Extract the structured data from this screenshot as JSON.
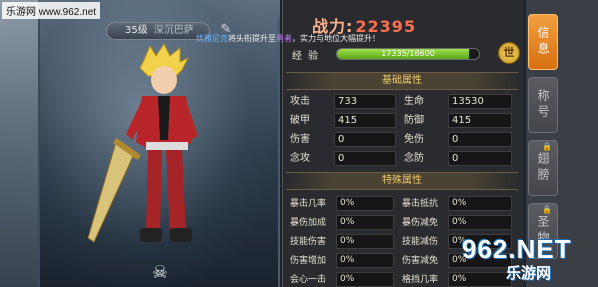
{
  "watermark": {
    "site": "乐游网 www.962.net",
    "logo_big": "962.NET",
    "logo_small": "乐游网"
  },
  "character": {
    "level": "35级",
    "name": "深沉巴萨",
    "bottom_item_icon": "skull-icon"
  },
  "banner": {
    "link": "优雅尼克",
    "text1": "将头衔提升至",
    "title": "勇者",
    "text2": "，实力与地位大幅提升！"
  },
  "power": {
    "label": "战力:",
    "value": "22395"
  },
  "exp": {
    "label": "经验",
    "text": "17335/18600",
    "fraction": 0.932,
    "world_button": "世"
  },
  "basic": {
    "title": "基础属性",
    "rows": [
      {
        "l_label": "攻击",
        "l_value": "733",
        "r_label": "生命",
        "r_value": "13530"
      },
      {
        "l_label": "破甲",
        "l_value": "415",
        "r_label": "防御",
        "r_value": "415"
      },
      {
        "l_label": "伤害",
        "l_value": "0",
        "r_label": "免伤",
        "r_value": "0"
      },
      {
        "l_label": "念攻",
        "l_value": "0",
        "r_label": "念防",
        "r_value": "0"
      }
    ]
  },
  "special": {
    "title": "特殊属性",
    "rows": [
      {
        "l_label": "暴击几率",
        "l_value": "0%",
        "r_label": "暴击抵抗",
        "r_value": "0%"
      },
      {
        "l_label": "暴伤加成",
        "l_value": "0%",
        "r_label": "暴伤减免",
        "r_value": "0%"
      },
      {
        "l_label": "技能伤害",
        "l_value": "0%",
        "r_label": "技能减伤",
        "r_value": "0%"
      },
      {
        "l_label": "伤害增加",
        "l_value": "0%",
        "r_label": "伤害减免",
        "r_value": "0%"
      },
      {
        "l_label": "会心一击",
        "l_value": "0%",
        "r_label": "格挡几率",
        "r_value": "0%"
      }
    ]
  },
  "tabs": [
    {
      "label": "信息",
      "active": true,
      "locked": false
    },
    {
      "label": "称号",
      "active": false,
      "locked": false
    },
    {
      "label": "翅膀",
      "active": false,
      "locked": true
    },
    {
      "label": "圣物",
      "active": false,
      "locked": true
    }
  ],
  "colors": {
    "power": "#ff6f4d",
    "section_title": "#f0c96c",
    "tab_active": "#e8881c",
    "exp_fill": "#7cc832"
  }
}
